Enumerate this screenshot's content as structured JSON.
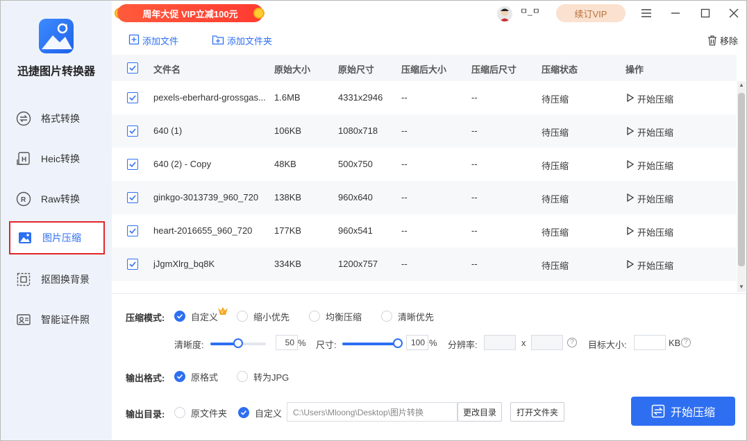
{
  "promo": {
    "text": "周年大促 VIP立减100元"
  },
  "user": {
    "name": "ㅁ_ㅁ"
  },
  "vip_button": "续订VIP",
  "app": {
    "name": "迅捷图片转换器"
  },
  "sidebar": {
    "items": [
      {
        "label": "格式转换",
        "icon": "swap-icon"
      },
      {
        "label": "Heic转换",
        "icon": "heic-icon"
      },
      {
        "label": "Raw转换",
        "icon": "raw-icon"
      },
      {
        "label": "图片压缩",
        "icon": "image-compress-icon",
        "active": true
      },
      {
        "label": "抠图换背景",
        "icon": "cutout-icon"
      },
      {
        "label": "智能证件照",
        "icon": "id-photo-icon"
      }
    ]
  },
  "toolbar": {
    "add_file": "添加文件",
    "add_folder": "添加文件夹",
    "remove": "移除"
  },
  "table": {
    "headers": [
      "文件名",
      "原始大小",
      "原始尺寸",
      "压缩后大小",
      "压缩后尺寸",
      "压缩状态",
      "操作"
    ],
    "rows": [
      {
        "name": "pexels-eberhard-grossgas...",
        "size": "1.6MB",
        "dim": "4331x2946",
        "csize": "--",
        "cdim": "--",
        "status": "待压缩",
        "action": "开始压缩"
      },
      {
        "name": "640 (1)",
        "size": "106KB",
        "dim": "1080x718",
        "csize": "--",
        "cdim": "--",
        "status": "待压缩",
        "action": "开始压缩"
      },
      {
        "name": "640 (2) - Copy",
        "size": "48KB",
        "dim": "500x750",
        "csize": "--",
        "cdim": "--",
        "status": "待压缩",
        "action": "开始压缩"
      },
      {
        "name": "ginkgo-3013739_960_720",
        "size": "138KB",
        "dim": "960x640",
        "csize": "--",
        "cdim": "--",
        "status": "待压缩",
        "action": "开始压缩"
      },
      {
        "name": "heart-2016655_960_720",
        "size": "177KB",
        "dim": "960x541",
        "csize": "--",
        "cdim": "--",
        "status": "待压缩",
        "action": "开始压缩"
      },
      {
        "name": "jJgmXlrg_bq8K",
        "size": "334KB",
        "dim": "1200x757",
        "csize": "--",
        "cdim": "--",
        "status": "待压缩",
        "action": "开始压缩"
      }
    ]
  },
  "settings": {
    "mode_label": "压缩模式:",
    "modes": [
      "自定义",
      "缩小优先",
      "均衡压缩",
      "清晰优先"
    ],
    "clarity_label": "清晰度:",
    "clarity_value": "50",
    "clarity_fraction": 0.5,
    "size_label": "尺寸:",
    "size_value": "100",
    "size_fraction": 1.0,
    "percent": "%",
    "resolution_label": "分辨率:",
    "x": "x",
    "target_label": "目标大小:",
    "kb": "KB",
    "format_label": "输出格式:",
    "formats": [
      "原格式",
      "转为JPG"
    ],
    "dir_label": "输出目录:",
    "dirs": [
      "原文件夹",
      "自定义"
    ],
    "path": "C:\\Users\\Mloong\\Desktop\\图片转换",
    "change_dir": "更改目录",
    "open_folder": "打开文件夹",
    "start": "开始压缩"
  },
  "colors": {
    "accent": "#2e6ff2",
    "sidebar_bg": "#eef3fb",
    "highlight": "#e0262a"
  }
}
